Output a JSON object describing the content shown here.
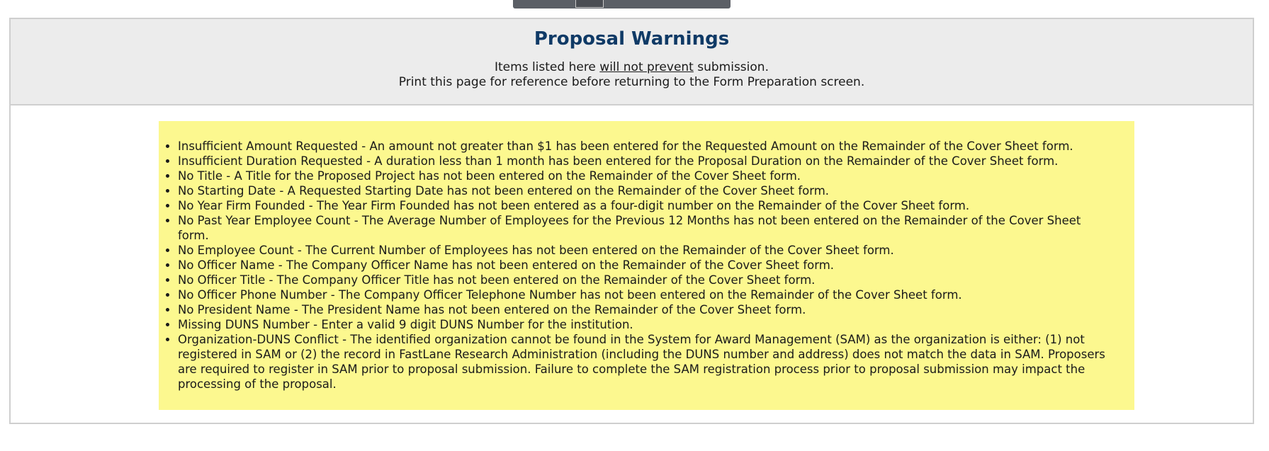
{
  "header": {
    "title": "Proposal Warnings",
    "line1_prefix": "Items listed here ",
    "line1_emphasis": "will not prevent",
    "line1_suffix": " submission.",
    "line2": "Print this page for reference before returning to the Form Preparation screen."
  },
  "warnings": [
    "Insufficient Amount Requested - An amount not greater than $1 has been entered for the Requested Amount on the Remainder of the Cover Sheet form.",
    "Insufficient Duration Requested - A duration less than 1 month has been entered for the Proposal Duration on the Remainder of the Cover Sheet form.",
    "No Title - A Title for the Proposed Project has not been entered on the Remainder of the Cover Sheet form.",
    "No Starting Date - A Requested Starting Date has not been entered on the Remainder of the Cover Sheet form.",
    "No Year Firm Founded - The Year Firm Founded has not been entered as a four-digit number on the Remainder of the Cover Sheet form.",
    "No Past Year Employee Count - The Average Number of Employees for the Previous 12 Months has not been entered on the Remainder of the Cover Sheet form.",
    "No Employee Count - The Current Number of Employees has not been entered on the Remainder of the Cover Sheet form.",
    "No Officer Name - The Company Officer Name has not been entered on the Remainder of the Cover Sheet form.",
    "No Officer Title - The Company Officer Title has not been entered on the Remainder of the Cover Sheet form.",
    "No Officer Phone Number - The Company Officer Telephone Number has not been entered on the Remainder of the Cover Sheet form.",
    "No President Name - The President Name has not been entered on the Remainder of the Cover Sheet form.",
    "Missing DUNS Number - Enter a valid 9 digit DUNS Number for the institution.",
    "Organization-DUNS Conflict - The identified organization cannot be found in the System for Award Management (SAM) as the organization is either: (1) not registered in SAM or (2) the record in FastLane Research Administration (including the DUNS number and address) does not match the data in SAM. Proposers are required to register in SAM prior to proposal submission. Failure to complete the SAM registration process prior to proposal submission may impact the processing of the proposal."
  ],
  "colors": {
    "title": "#0f3a66",
    "header_bg": "#ececec",
    "warning_bg": "#fcf88f"
  }
}
